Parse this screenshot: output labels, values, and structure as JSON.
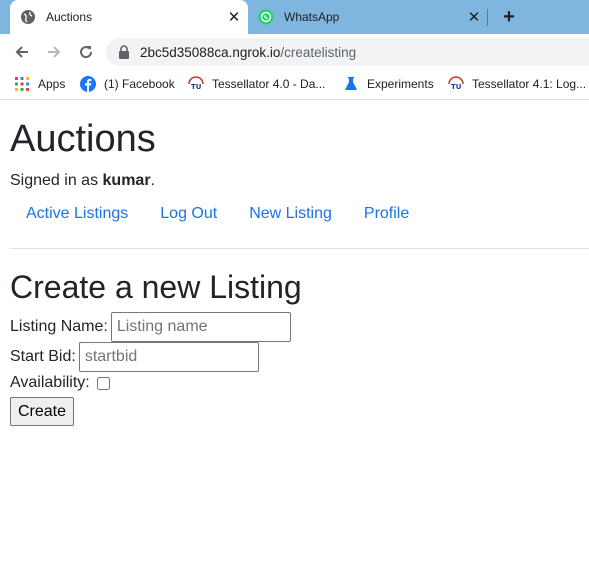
{
  "browser": {
    "tabs": [
      {
        "title": "Auctions",
        "icon": "globe-icon",
        "active": true
      },
      {
        "title": "WhatsApp",
        "icon": "whatsapp-icon",
        "active": false
      }
    ],
    "new_tab_label": "+",
    "url_host": "2bc5d35088ca.ngrok.io",
    "url_path": "/createlisting",
    "bookmarks": [
      {
        "label": "Apps",
        "icon": "apps-grid-icon"
      },
      {
        "label": "(1) Facebook",
        "icon": "facebook-icon"
      },
      {
        "label": "Tessellator 4.0 - Da...",
        "icon": "tessellator-icon"
      },
      {
        "label": "Experiments",
        "icon": "flask-icon"
      },
      {
        "label": "Tessellator 4.1: Log...",
        "icon": "tessellator-icon"
      }
    ],
    "colors": {
      "tabstrip": "#7fb6df",
      "omnibox": "#f1f3f4"
    }
  },
  "page": {
    "title": "Auctions",
    "signed_in_prefix": "Signed in as ",
    "username": "kumar",
    "signed_in_suffix": ".",
    "nav": [
      {
        "label": "Active Listings"
      },
      {
        "label": "Log Out"
      },
      {
        "label": "New Listing"
      },
      {
        "label": "Profile"
      }
    ],
    "link_color": "#1a73e8"
  },
  "form": {
    "title": "Create a new Listing",
    "name_label": "Listing Name:",
    "name_placeholder": "Listing name",
    "bid_label": "Start Bid:",
    "bid_placeholder": "startbid",
    "availability_label": "Availability:",
    "availability_checked": false,
    "submit_label": "Create"
  }
}
